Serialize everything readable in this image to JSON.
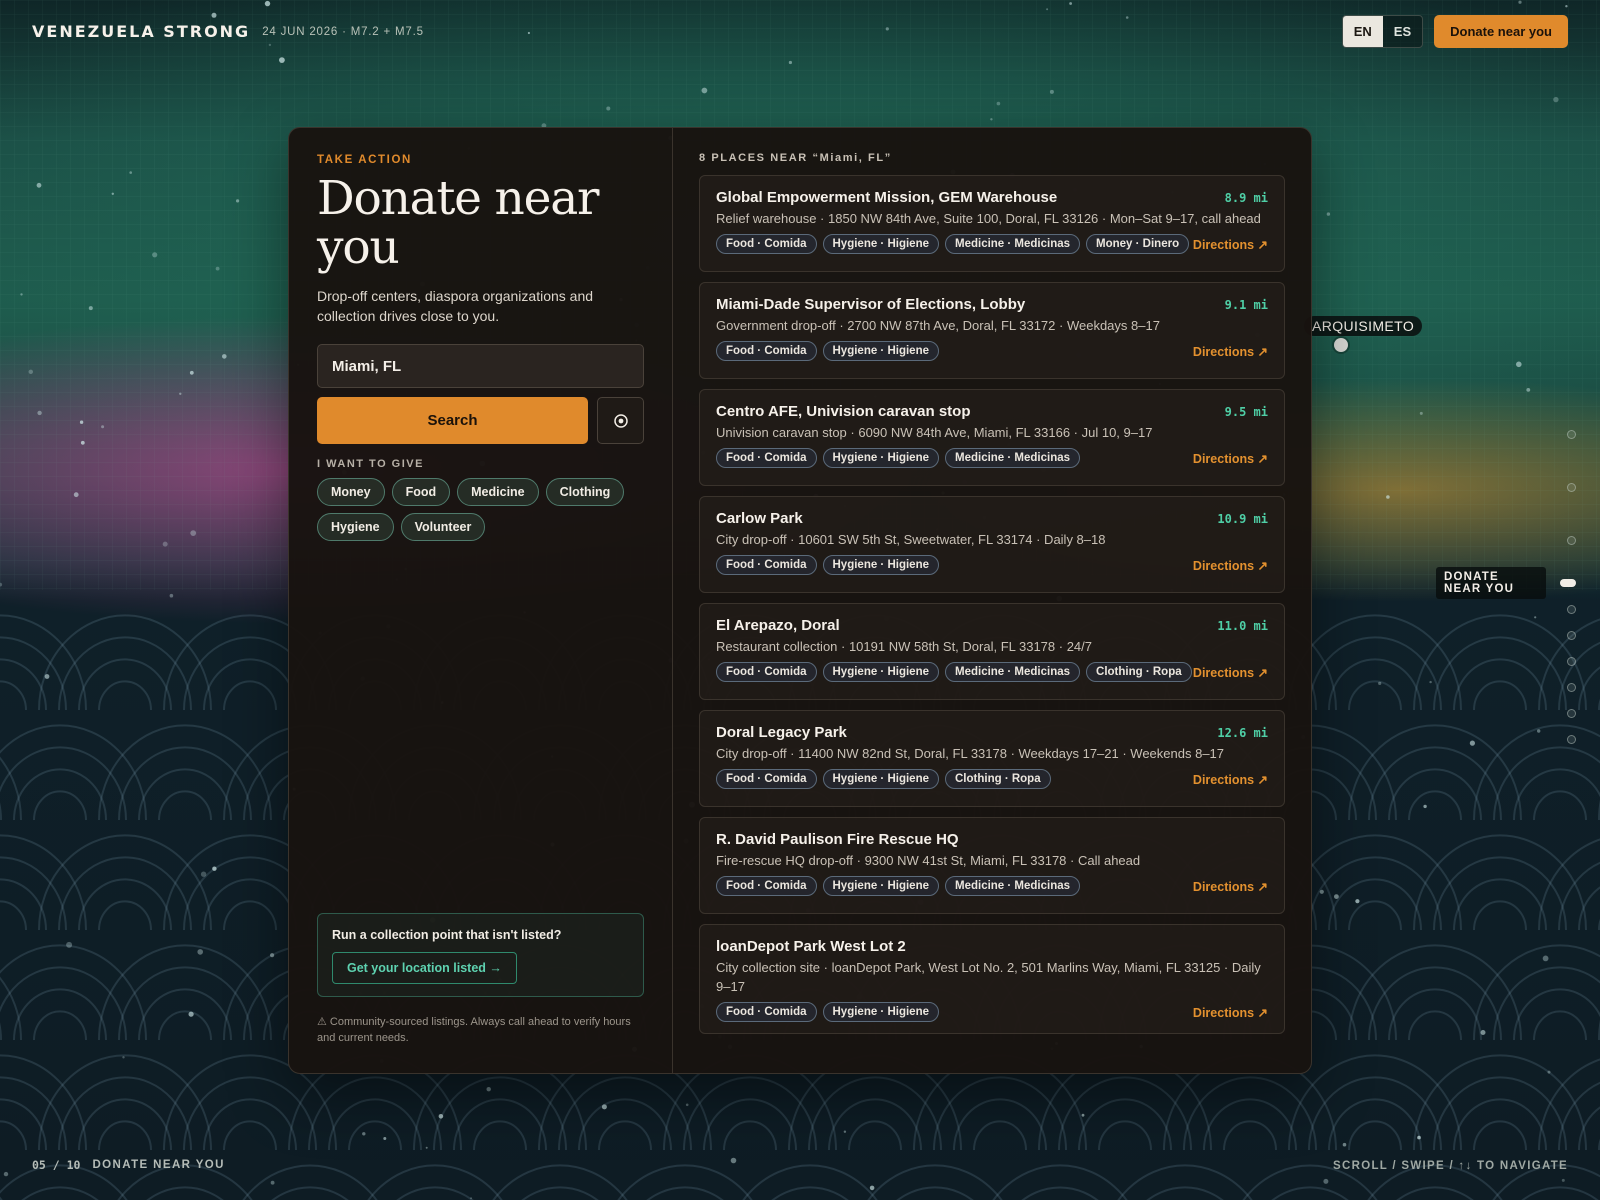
{
  "header": {
    "brand": "VENEZUELA STRONG",
    "meta": "24 JUN 2026 · M7.2 + M7.5",
    "languages": [
      {
        "code": "EN",
        "active": true
      },
      {
        "code": "ES",
        "active": false
      }
    ],
    "donate_button": "Donate near you"
  },
  "map": {
    "city_label": "ARQUISIMETO"
  },
  "section_nav": {
    "current_label": "DONATE NEAR YOU"
  },
  "left": {
    "eyebrow": "TAKE ACTION",
    "title": "Donate near you",
    "subtitle": "Drop-off centers, diaspora organizations and collection drives close to you.",
    "search_value": "Miami, FL",
    "search_button": "Search",
    "locate_icon": "locate-icon",
    "give_label": "I WANT TO GIVE",
    "give_options": [
      "Money",
      "Food",
      "Medicine",
      "Clothing",
      "Hygiene",
      "Volunteer"
    ],
    "listed_question": "Run a collection point that isn't listed?",
    "listed_button": "Get your location listed →",
    "disclaimer": "⚠ Community-sourced listings. Always call ahead to verify hours and current needs."
  },
  "results": {
    "header": "8 PLACES NEAR “Miami, FL”",
    "directions_label": "Directions ↗",
    "items": [
      {
        "name": "Global Empowerment Mission, GEM Warehouse",
        "distance": "8.9 mi",
        "meta": "Relief warehouse · 1850 NW 84th Ave, Suite 100, Doral, FL 33126 · Mon–Sat 9–17, call ahead",
        "tags": [
          "Food · Comida",
          "Hygiene · Higiene",
          "Medicine · Medicinas",
          "Money · Dinero"
        ]
      },
      {
        "name": "Miami-Dade Supervisor of Elections, Lobby",
        "distance": "9.1 mi",
        "meta": "Government drop-off · 2700 NW 87th Ave, Doral, FL 33172 · Weekdays 8–17",
        "tags": [
          "Food · Comida",
          "Hygiene · Higiene"
        ]
      },
      {
        "name": "Centro AFE, Univision caravan stop",
        "distance": "9.5 mi",
        "meta": "Univision caravan stop · 6090 NW 84th Ave, Miami, FL 33166 · Jul 10, 9–17",
        "tags": [
          "Food · Comida",
          "Hygiene · Higiene",
          "Medicine · Medicinas"
        ]
      },
      {
        "name": "Carlow Park",
        "distance": "10.9 mi",
        "meta": "City drop-off · 10601 SW 5th St, Sweetwater, FL 33174 · Daily 8–18",
        "tags": [
          "Food · Comida",
          "Hygiene · Higiene"
        ]
      },
      {
        "name": "El Arepazo, Doral",
        "distance": "11.0 mi",
        "meta": "Restaurant collection · 10191 NW 58th St, Doral, FL 33178 · 24/7",
        "tags": [
          "Food · Comida",
          "Hygiene · Higiene",
          "Medicine · Medicinas",
          "Clothing · Ropa"
        ]
      },
      {
        "name": "Doral Legacy Park",
        "distance": "12.6 mi",
        "meta": "City drop-off · 11400 NW 82nd St, Doral, FL 33178 · Weekdays 17–21 · Weekends 8–17",
        "tags": [
          "Food · Comida",
          "Hygiene · Higiene",
          "Clothing · Ropa"
        ]
      },
      {
        "name": "R. David Paulison Fire Rescue HQ",
        "distance": "",
        "meta": "Fire-rescue HQ drop-off · 9300 NW 41st St, Miami, FL 33178 · Call ahead",
        "tags": [
          "Food · Comida",
          "Hygiene · Higiene",
          "Medicine · Medicinas"
        ]
      },
      {
        "name": "loanDepot Park West Lot 2",
        "distance": "",
        "meta": "City collection site · loanDepot Park, West Lot No. 2, 501 Marlins Way, Miami, FL 33125 · Daily 9–17",
        "tags": [
          "Food · Comida",
          "Hygiene · Higiene"
        ]
      }
    ]
  },
  "footer": {
    "count": "05 / 10",
    "section": "DONATE NEAR YOU",
    "hint": "SCROLL / SWIPE / ↑↓ TO NAVIGATE"
  },
  "colors": {
    "accent": "#e08a2c",
    "distance": "#4fcfa6",
    "panel": "#181310"
  }
}
